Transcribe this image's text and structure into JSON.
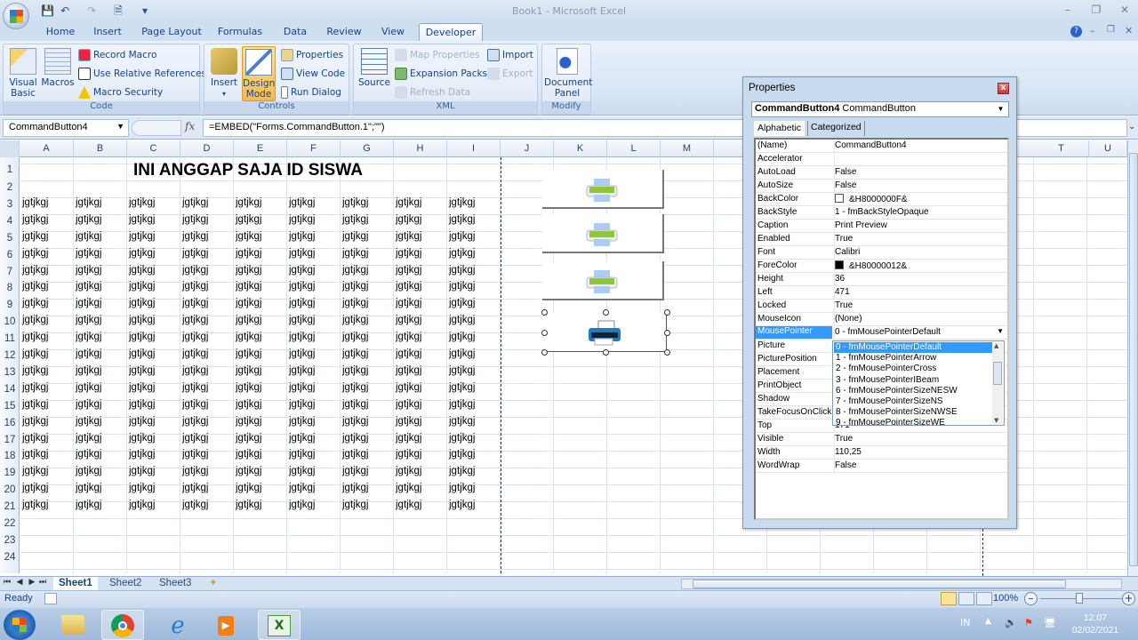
{
  "window": {
    "title": "Book1 - Microsoft Excel",
    "controls": [
      "minimize",
      "restore",
      "close"
    ]
  },
  "quick_access": [
    "save-icon",
    "undo-icon",
    "redo-icon",
    "print-preview-icon",
    "customize-icon"
  ],
  "ribbon": {
    "tabs": [
      "Home",
      "Insert",
      "Page Layout",
      "Formulas",
      "Data",
      "Review",
      "View",
      "Developer"
    ],
    "active_tab": "Developer",
    "groups": {
      "code": {
        "label": "Code",
        "visual_basic": "Visual Basic",
        "macros": "Macros",
        "record_macro": "Record Macro",
        "use_relative": "Use Relative References",
        "macro_security": "Macro Security"
      },
      "controls": {
        "label": "Controls",
        "insert": "Insert",
        "design_mode": "Design Mode",
        "properties": "Properties",
        "view_code": "View Code",
        "run_dialog": "Run Dialog"
      },
      "xml": {
        "label": "XML",
        "source": "Source",
        "map_properties": "Map Properties",
        "expansion_packs": "Expansion Packs",
        "refresh_data": "Refresh Data",
        "import": "Import",
        "export": "Export"
      },
      "modify": {
        "label": "Modify",
        "document_panel": "Document Panel"
      }
    }
  },
  "formula_bar": {
    "name_box": "CommandButton4",
    "fx": "fx",
    "formula": "=EMBED(\"Forms.CommandButton.1\";\"\")"
  },
  "sheet": {
    "columns": [
      "A",
      "B",
      "C",
      "D",
      "E",
      "F",
      "G",
      "H",
      "I",
      "J",
      "K",
      "L",
      "M",
      "T",
      "U"
    ],
    "rows": [
      "1",
      "2",
      "3",
      "4",
      "5",
      "6",
      "7",
      "8",
      "9",
      "10",
      "11",
      "12",
      "13",
      "14",
      "15",
      "16",
      "17",
      "18",
      "19",
      "20",
      "21",
      "22",
      "23",
      "24"
    ],
    "heading": "INI ANGGAP SAJA ID SISWA",
    "cell_text": "jgtjkgj",
    "filled_rows": 19,
    "filled_cols": 9
  },
  "properties_window": {
    "title": "Properties",
    "object_name": "CommandButton4",
    "object_type": "CommandButton",
    "tabs": [
      "Alphabetic",
      "Categorized"
    ],
    "rows": [
      {
        "name": "(Name)",
        "value": "CommandButton4"
      },
      {
        "name": "Accelerator",
        "value": ""
      },
      {
        "name": "AutoLoad",
        "value": "False"
      },
      {
        "name": "AutoSize",
        "value": "False"
      },
      {
        "name": "BackColor",
        "value": "&H8000000F&",
        "swatch": "#ffffff"
      },
      {
        "name": "BackStyle",
        "value": "1 - fmBackStyleOpaque"
      },
      {
        "name": "Caption",
        "value": "Print Preview"
      },
      {
        "name": "Enabled",
        "value": "True"
      },
      {
        "name": "Font",
        "value": "Calibri"
      },
      {
        "name": "ForeColor",
        "value": "&H80000012&",
        "swatch": "#000000"
      },
      {
        "name": "Height",
        "value": "36"
      },
      {
        "name": "Left",
        "value": "471"
      },
      {
        "name": "Locked",
        "value": "True"
      },
      {
        "name": "MouseIcon",
        "value": "(None)"
      },
      {
        "name": "MousePointer",
        "value": "0 - fmMousePointerDefault",
        "selected": true
      },
      {
        "name": "Picture",
        "value": ""
      },
      {
        "name": "PicturePosition",
        "value": ""
      },
      {
        "name": "Placement",
        "value": ""
      },
      {
        "name": "PrintObject",
        "value": ""
      },
      {
        "name": "Shadow",
        "value": ""
      },
      {
        "name": "TakeFocusOnClick",
        "value": ""
      },
      {
        "name": "Top",
        "value": "171"
      },
      {
        "name": "Visible",
        "value": "True"
      },
      {
        "name": "Width",
        "value": "110,25"
      },
      {
        "name": "WordWrap",
        "value": "False"
      }
    ],
    "dropdown_options": [
      "0 - fmMousePointerDefault",
      "1 - fmMousePointerArrow",
      "2 - fmMousePointerCross",
      "3 - fmMousePointerIBeam",
      "6 - fmMousePointerSizeNESW",
      "7 - fmMousePointerSizeNS",
      "8 - fmMousePointerSizeNWSE",
      "9 - fmMousePointerSizeWE"
    ],
    "dropdown_selected": 0
  },
  "sheet_tabs": [
    "Sheet1",
    "Sheet2",
    "Sheet3"
  ],
  "active_sheet": "Sheet1",
  "status": {
    "ready": "Ready",
    "zoom": "100%"
  },
  "taskbar": {
    "apps": [
      "start",
      "explorer",
      "chrome",
      "internet-explorer",
      "media-player",
      "excel"
    ],
    "language": "IN",
    "time": "12:07",
    "date": "02/02/2021"
  },
  "colors": {
    "accent": "#3399ff",
    "ribbon": "#dfe9f5",
    "design_mode_active": "#f9c25a"
  }
}
